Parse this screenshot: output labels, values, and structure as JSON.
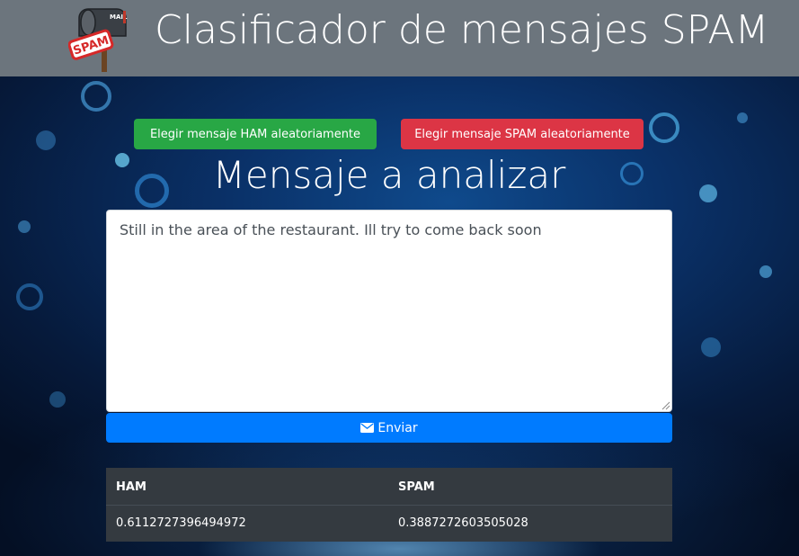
{
  "header": {
    "title": "Clasificador de mensajes SPAM",
    "logo": {
      "icon": "spam-mailbox-logo",
      "mailbox_text": "MAIL",
      "stamp_text": "SPAM"
    }
  },
  "actions": {
    "ham_button_label": "Elegir mensaje HAM aleatoriamente",
    "spam_button_label": "Elegir mensaje SPAM aleatoriamente"
  },
  "form": {
    "section_title": "Mensaje a analizar",
    "message_value": "Still in the area of the restaurant. Ill try to come back soon",
    "send_label": "Enviar",
    "send_icon": "envelope-icon"
  },
  "results": {
    "headers": [
      "HAM",
      "SPAM"
    ],
    "values": [
      "0.6112727396494972",
      "0.3887272603505028"
    ]
  },
  "colors": {
    "header_bg": "#6c757d",
    "ham_green": "#28a745",
    "spam_red": "#dc3545",
    "send_blue": "#007bff",
    "table_bg": "#343a40"
  }
}
